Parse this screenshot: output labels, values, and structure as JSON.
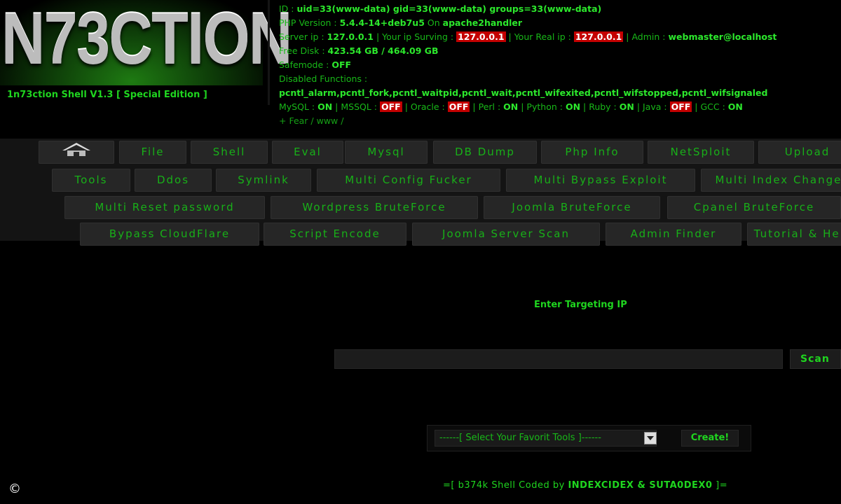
{
  "logo": {
    "text": "N73CTION"
  },
  "shell_version": "1n73ction Shell V1.3 [ Special Edition ]",
  "info": {
    "id_label": "ID :",
    "id_value": "uid=33(www-data) gid=33(www-data) groups=33(www-data)",
    "php_label": "PHP Version :",
    "php_value": "5.4.4-14+deb7u5",
    "php_on": "On",
    "php_server": "apache2handler",
    "server_ip_label": "Server ip :",
    "server_ip": "127.0.0.1",
    "your_ip_label": "| Your ip Surving :",
    "your_ip": "127.0.0.1",
    "real_ip_label": "| Your Real ip :",
    "real_ip": "127.0.0.1",
    "admin_label": "| Admin :",
    "admin_value": "webmaster@localhost",
    "free_disk_label": "Free Disk :",
    "free_disk_value": "423.54 GB / 464.09 GB",
    "safemode_label": "Safemode :",
    "safemode_value": "OFF",
    "disabled_label": "Disabled Functions :",
    "disabled_value": "pcntl_alarm,pcntl_fork,pcntl_waitpid,pcntl_wait,pcntl_wifexited,pcntl_wifstopped,pcntl_wifsignaled",
    "mysql_label": "MySQL :",
    "mysql_value": "ON",
    "mssql_label": "| MSSQL :",
    "mssql_value": "OFF",
    "oracle_label": "| Oracle :",
    "oracle_value": "OFF",
    "perl_label": "| Perl :",
    "perl_value": "ON",
    "python_label": "| Python :",
    "python_value": "ON",
    "ruby_label": "| Ruby :",
    "ruby_value": "ON",
    "java_label": "| Java :",
    "java_value": "OFF",
    "gcc_label": "| GCC :",
    "gcc_value": "ON",
    "fear_line": "+ Fear / www /"
  },
  "menu": {
    "home_icon": "home-icon",
    "row1": [
      "File",
      "Shell",
      "Eval",
      "Mysql",
      "DB Dump",
      "Php Info",
      "NetSploit",
      "Upload"
    ],
    "row2": [
      "Tools",
      "Ddos",
      "Symlink",
      "Multi Config Fucker",
      "Multi Bypass Exploit",
      "Multi Index Changer"
    ],
    "row3": [
      "Multi Reset password",
      "Wordpress BruteForce",
      "Joomla BruteForce",
      "Cpanel BruteForce"
    ],
    "row4": [
      "Bypass CloudFlare",
      "Script Encode",
      "Joomla Server Scan",
      "Admin Finder",
      "Tutorial & Help"
    ]
  },
  "main": {
    "enter_target": "Enter Targeting IP",
    "ip_input_value": "",
    "scan_label": "Scan",
    "tools_select_label": "------[ Select Your Favorit Tools ]------",
    "create_label": "Create!"
  },
  "footer": {
    "prefix": "=[ b374k Shell ",
    "coded_by": "Coded by",
    "authors": "INDEXCIDEX & SUTA0DEX0",
    "suffix": " ]="
  },
  "colors": {
    "green": "#1fd51f",
    "red": "#c40000",
    "background": "#000000",
    "button": "#262626"
  }
}
